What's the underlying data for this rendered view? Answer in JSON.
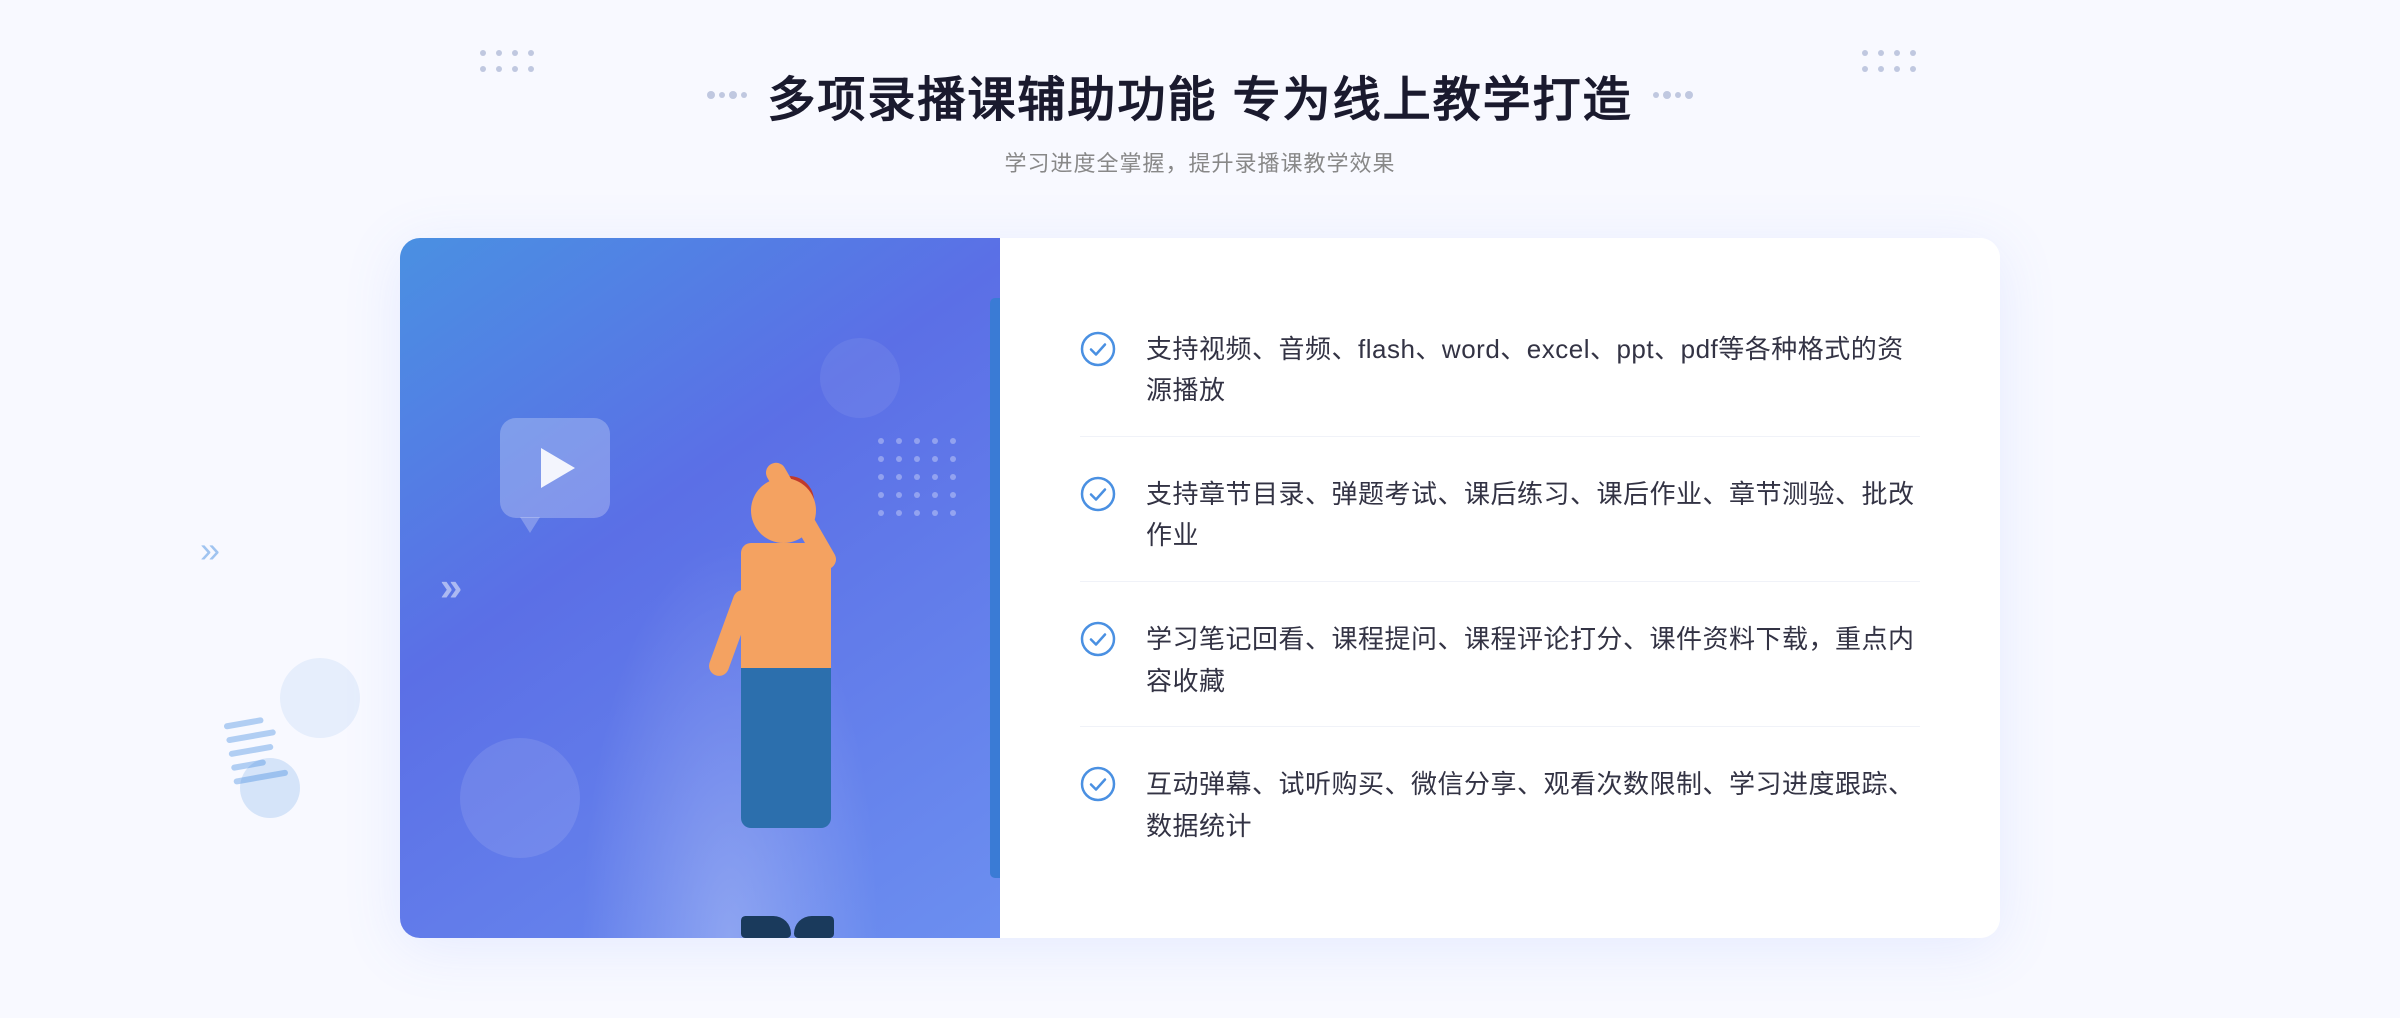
{
  "page": {
    "background_color": "#f8f9ff"
  },
  "header": {
    "title": "多项录播课辅助功能 专为线上教学打造",
    "subtitle": "学习进度全掌握，提升录播课教学效果"
  },
  "features": [
    {
      "id": 1,
      "text": "支持视频、音频、flash、word、excel、ppt、pdf等各种格式的资源播放"
    },
    {
      "id": 2,
      "text": "支持章节目录、弹题考试、课后练习、课后作业、章节测验、批改作业"
    },
    {
      "id": 3,
      "text": "学习笔记回看、课程提问、课程评论打分、课件资料下载，重点内容收藏"
    },
    {
      "id": 4,
      "text": "互动弹幕、试听购买、微信分享、观看次数限制、学习进度跟踪、数据统计"
    }
  ],
  "decorations": {
    "chevron_text": "»",
    "play_button_label": "play"
  },
  "colors": {
    "primary_blue": "#4a90e2",
    "gradient_start": "#4a90e2",
    "gradient_end": "#6c8ff0",
    "text_dark": "#1a1a2e",
    "text_light": "#888888",
    "check_color": "#4a90e2"
  }
}
